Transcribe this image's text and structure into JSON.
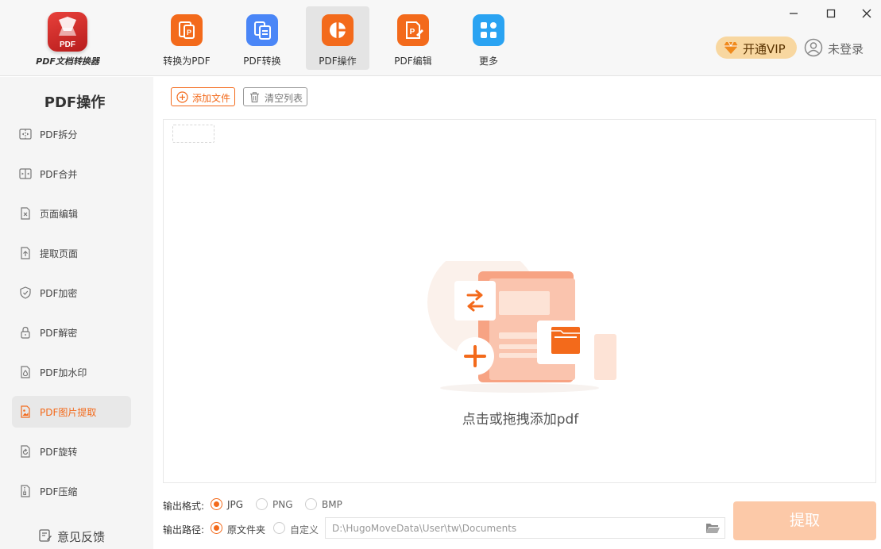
{
  "app": {
    "logo_label": "PDF文档转换器",
    "logo_icon": "pdf-logo-icon",
    "logo_icon_text": "PDF"
  },
  "nav": [
    {
      "label": "转换为PDF",
      "icon": "convert-to-pdf-icon",
      "color": "#f36a1b",
      "active": false
    },
    {
      "label": "PDF转换",
      "icon": "pdf-convert-icon",
      "color": "#4a86f7",
      "active": false
    },
    {
      "label": "PDF操作",
      "icon": "pdf-operation-icon",
      "color": "#f36a1b",
      "active": true
    },
    {
      "label": "PDF编辑",
      "icon": "pdf-edit-icon",
      "color": "#f36a1b",
      "active": false
    },
    {
      "label": "更多",
      "icon": "more-apps-icon",
      "color": "#2aa3f2",
      "active": false
    }
  ],
  "window_controls": [
    "minimize-icon",
    "maximize-icon",
    "close-icon"
  ],
  "vip": {
    "label": "开通VIP",
    "icon": "diamond-icon",
    "color": "#f8d7a0"
  },
  "login": {
    "label": "未登录",
    "icon": "user-avatar-icon"
  },
  "sidebar": {
    "title": "PDF操作",
    "items": [
      {
        "label": "PDF拆分",
        "icon": "split-icon",
        "active": false
      },
      {
        "label": "PDF合并",
        "icon": "merge-icon",
        "active": false
      },
      {
        "label": "页面编辑",
        "icon": "page-edit-icon",
        "active": false
      },
      {
        "label": "提取页面",
        "icon": "extract-page-icon",
        "active": false
      },
      {
        "label": "PDF加密",
        "icon": "shield-icon",
        "active": false
      },
      {
        "label": "PDF解密",
        "icon": "unlock-icon",
        "active": false
      },
      {
        "label": "PDF加水印",
        "icon": "watermark-icon",
        "active": false
      },
      {
        "label": "PDF图片提取",
        "icon": "image-extract-icon",
        "active": true
      },
      {
        "label": "PDF旋转",
        "icon": "rotate-icon",
        "active": false
      },
      {
        "label": "PDF压缩",
        "icon": "compress-icon",
        "active": false
      }
    ],
    "feedback": {
      "label": "意见反馈",
      "icon": "feedback-icon"
    }
  },
  "toolbar": {
    "add_label": "添加文件",
    "add_icon": "plus-circle-icon",
    "clear_label": "清空列表",
    "clear_icon": "trash-icon"
  },
  "drop_area": {
    "text": "点击或拖拽添加pdf",
    "icon": "add-file-illustration"
  },
  "output": {
    "format_label": "输出格式:",
    "formats": [
      {
        "label": "JPG",
        "selected": true
      },
      {
        "label": "PNG",
        "selected": false
      },
      {
        "label": "BMP",
        "selected": false
      }
    ],
    "path_label": "输出路径:",
    "path_options": [
      {
        "label": "原文件夹",
        "selected": true
      },
      {
        "label": "自定义",
        "selected": false
      }
    ],
    "path_value": "D:\\HugoMoveData\\User\\tw\\Documents",
    "folder_icon": "folder-open-icon"
  },
  "extract_button": {
    "label": "提取",
    "color": "#fcc9a8"
  },
  "accent_color": "#f36a1b"
}
